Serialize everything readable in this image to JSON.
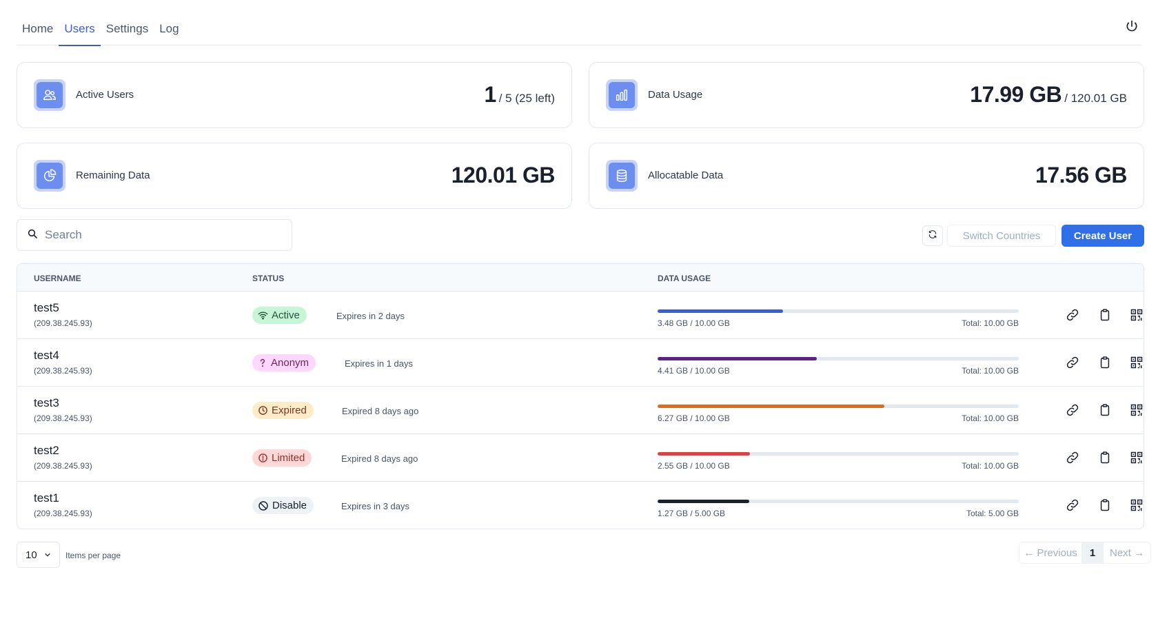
{
  "nav": {
    "tabs": [
      {
        "label": "Home"
      },
      {
        "label": "Users"
      },
      {
        "label": "Settings"
      },
      {
        "label": "Log"
      }
    ],
    "active_tab": "Users"
  },
  "stats": {
    "active_users": {
      "label": "Active Users",
      "value": "1",
      "sub": "/ 5 (25 left)"
    },
    "data_usage": {
      "label": "Data Usage",
      "value": "17.99 GB",
      "sub": "/ 120.01 GB"
    },
    "remaining_data": {
      "label": "Remaining Data",
      "value": "120.01 GB"
    },
    "allocatable_data": {
      "label": "Allocatable Data",
      "value": "17.56 GB"
    }
  },
  "toolbar": {
    "search_placeholder": "Search",
    "switch_label": "Switch Countries",
    "create_label": "Create User"
  },
  "table": {
    "headers": {
      "username": "USERNAME",
      "status": "STATUS",
      "data_usage": "DATA USAGE"
    },
    "rows": [
      {
        "username": "test5",
        "ip": "(209.38.245.93)",
        "status": "Active",
        "expiry": "Expires in 2 days",
        "used": "3.48 GB / 10.00 GB",
        "total": "Total: 10.00 GB",
        "progress": 0.348
      },
      {
        "username": "test4",
        "ip": "(209.38.245.93)",
        "status": "Anonym",
        "expiry": "Expires in 1 days",
        "used": "4.41 GB / 10.00 GB",
        "total": "Total: 10.00 GB",
        "progress": 0.441
      },
      {
        "username": "test3",
        "ip": "(209.38.245.93)",
        "status": "Expired",
        "expiry": "Expired 8 days ago",
        "used": "6.27 GB / 10.00 GB",
        "total": "Total: 10.00 GB",
        "progress": 0.627
      },
      {
        "username": "test2",
        "ip": "(209.38.245.93)",
        "status": "Limited",
        "expiry": "Expired 8 days ago",
        "used": "2.55 GB / 10.00 GB",
        "total": "Total: 10.00 GB",
        "progress": 0.255
      },
      {
        "username": "test1",
        "ip": "(209.38.245.93)",
        "status": "Disable",
        "expiry": "Expires in 3 days",
        "used": "1.27 GB / 5.00 GB",
        "total": "Total: 5.00 GB",
        "progress": 0.254
      }
    ]
  },
  "status_styles": {
    "Active": {
      "bg": "#c6f6d5",
      "fg": "#22543d",
      "bar": "#3b5bdb",
      "icon": "wifi-icon"
    },
    "Anonym": {
      "bg": "#fed7fe",
      "fg": "#702459",
      "bar": "#5b2185",
      "icon": "question-icon"
    },
    "Expired": {
      "bg": "#feebc8",
      "fg": "#7b341e",
      "bar": "#dd6b20",
      "icon": "clock-icon"
    },
    "Limited": {
      "bg": "#fed7d7",
      "fg": "#9b2c2c",
      "bar": "#e53e3e",
      "icon": "alert-circle-icon"
    },
    "Disable": {
      "bg": "#edf2f7",
      "fg": "#1a202c",
      "bar": "#1a202c",
      "icon": "ban-icon"
    }
  },
  "pagination": {
    "per_page": "10",
    "per_page_label": "Items per page",
    "prev": "← Previous",
    "page": "1",
    "next": "Next →"
  },
  "colors": {
    "accent": "#2f6fe8",
    "nav_active": "#3b5bdb",
    "stat_icon_bg": "#6b8ef0"
  }
}
